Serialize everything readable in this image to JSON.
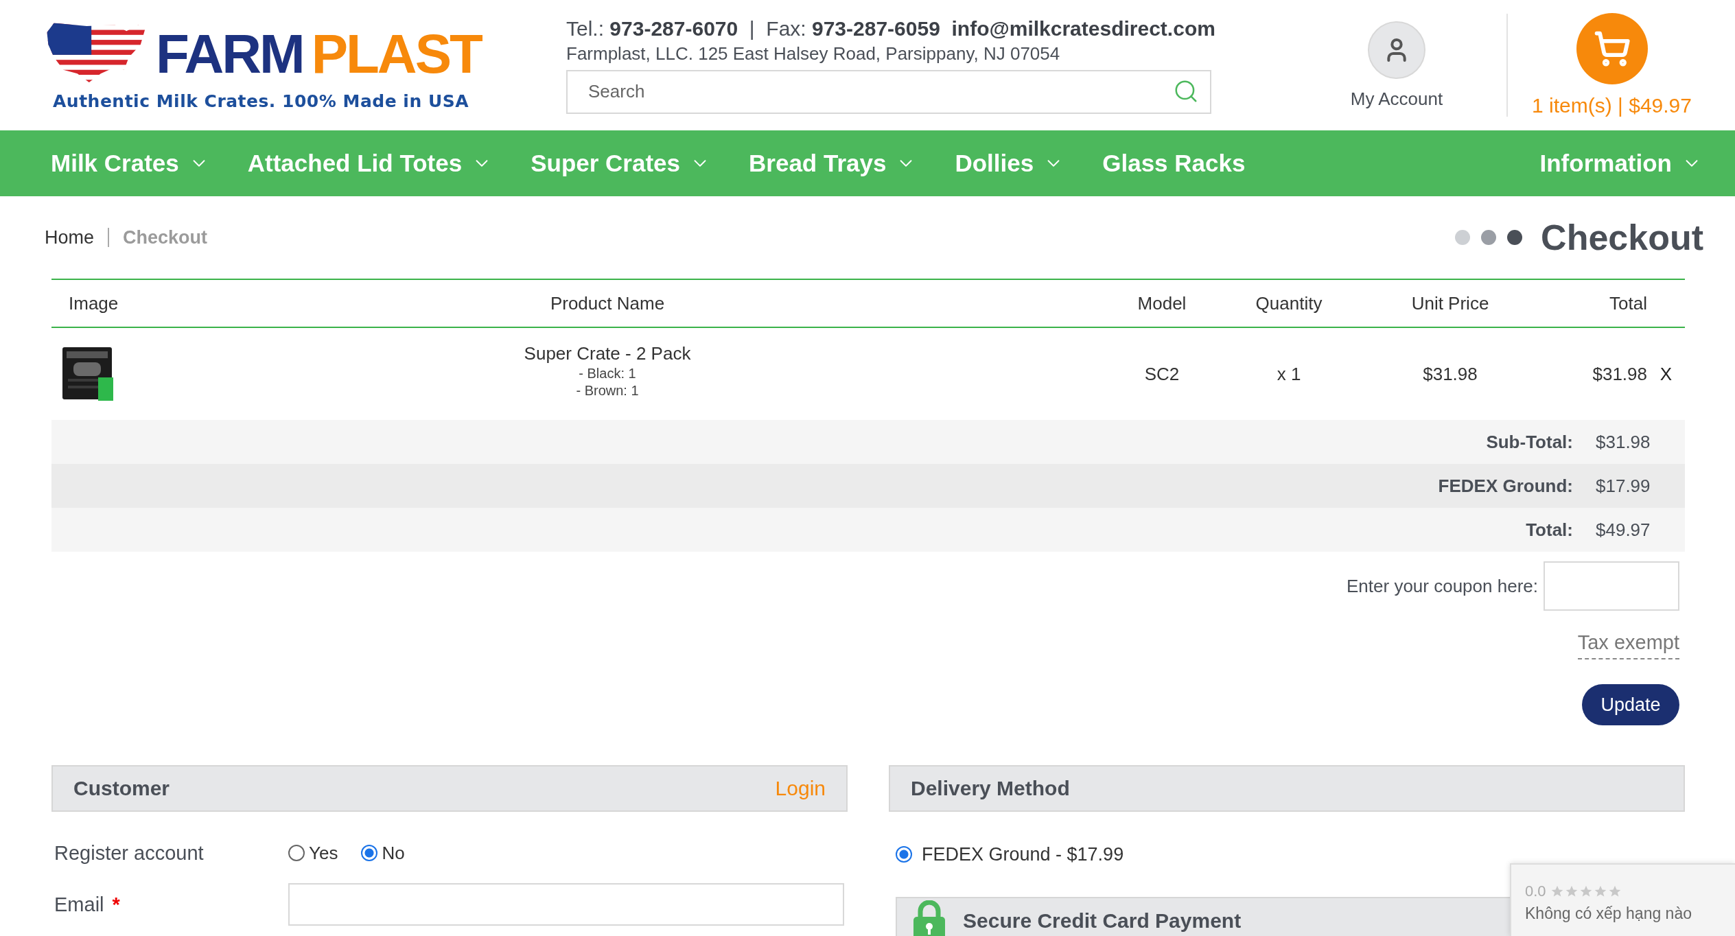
{
  "header": {
    "logo": {
      "brand_first": "FARM",
      "brand_second": "PLAST",
      "tagline": "Authentic Milk Crates. 100% Made in USA"
    },
    "contact": "Tel.: **973-287-6070**  |  Fax: **973-287-6059**  **info@milkcratesdirect.com**",
    "address": "Farmplast, LLC. 125 East Halsey Road, Parsippany, NJ 07054",
    "search": {
      "placeholder": "Search"
    },
    "account": "My Account",
    "cart": "1 item(s) | $49.97"
  },
  "nav": [
    {
      "label": "Milk Crates",
      "has_menu": true
    },
    {
      "label": "Attached Lid Totes",
      "has_menu": true
    },
    {
      "label": "Super Crates",
      "has_menu": true
    },
    {
      "label": "Bread Trays",
      "has_menu": true
    },
    {
      "label": "Dollies",
      "has_menu": true
    },
    {
      "label": "Glass Racks",
      "has_menu": false
    }
  ],
  "nav_right": {
    "label": "Information",
    "has_menu": true
  },
  "breadcrumb": [
    {
      "label": "Home",
      "selected": false
    },
    {
      "label": "Checkout",
      "selected": true
    }
  ],
  "page_title": "Checkout",
  "cart_table": {
    "columns": [
      "Image",
      "Product Name",
      "Model",
      "Quantity",
      "Unit Price",
      "Total"
    ],
    "rows": [
      {
        "image": {
          "kind": "picture"
        },
        "name": "Super Crate - 2 Pack",
        "options": [
          "- Black: 1",
          "- Brown: 1"
        ],
        "model": "SC2",
        "quantity": "x 1",
        "unit_price": "$31.98",
        "total": "$31.98",
        "remove": "X"
      }
    ],
    "totals": [
      {
        "label": "Sub-Total:",
        "value": "$31.98"
      },
      {
        "label": "FEDEX Ground:",
        "value": "$17.99"
      },
      {
        "label": "Total:",
        "value": "$49.97"
      }
    ]
  },
  "coupon": {
    "label": "Enter your coupon here:"
  },
  "tax_exempt": "Tax exempt",
  "update_button": "Update",
  "customer": {
    "title": "Customer",
    "login": "Login",
    "register": {
      "label": "Register account",
      "options": [
        {
          "label": "Yes",
          "selected": false
        },
        {
          "label": "No",
          "selected": true
        }
      ]
    },
    "email": {
      "label": "Email",
      "required_mark": "*"
    }
  },
  "delivery": {
    "title": "Delivery Method",
    "options": [
      {
        "label": "FEDEX Ground - $17.99",
        "selected": true
      }
    ]
  },
  "payment": {
    "title": "Secure Credit Card Payment"
  },
  "rating_widget": {
    "score": "0.0",
    "stars": 0,
    "text": "Không có xếp hạng nào"
  }
}
